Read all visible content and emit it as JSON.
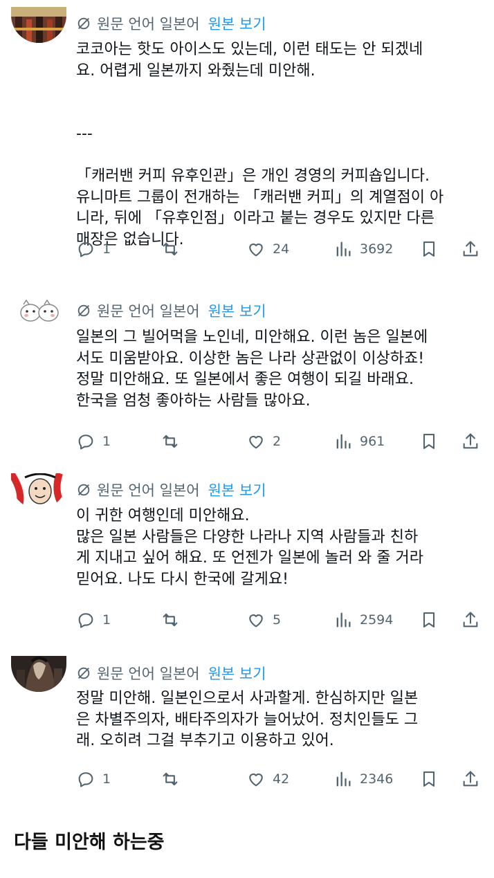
{
  "translate": {
    "label": "원문 언어 일본어",
    "link": "원본 보기"
  },
  "replies": [
    {
      "text": "코코아는 핫도 아이스도 있는데, 이런 태도는 안 되겠네\n요. 어렵게 일본까지 와줬는데 미안해.\n\n\n---\n\n「캐러밴 커피 유후인관」은 개인 경영의 커피숍입니다.\n유니마트 그룹이 전개하는 「캐러밴 커피」의 계열점이 아\n니라, 뒤에 「유후인점」이라고 붙는 경우도 있지만 다른\n매장은 없습니다.",
      "replies": "1",
      "likes": "24",
      "views": "3692"
    },
    {
      "text": "일본의 그 빌어먹을 노인네, 미안해요. 이런 놈은 일본에\n서도 미움받아요. 이상한 놈은 나라 상관없이 이상하죠!\n정말 미안해요. 또 일본에서 좋은 여행이 되길 바래요.\n한국을 엄청 좋아하는 사람들 많아요.",
      "replies": "1",
      "likes": "2",
      "views": "961"
    },
    {
      "text": "이 귀한 여행인데 미안해요.\n많은 일본 사람들은 다양한 나라나 지역 사람들과 친하\n게 지내고 싶어 해요. 또 언젠가 일본에 놀러 와 줄 거라\n믿어요. 나도 다시 한국에 갈게요!",
      "replies": "1",
      "likes": "5",
      "views": "2594"
    },
    {
      "text": "정말 미안해. 일본인으로서 사과할게. 한심하지만 일본\n은 차별주의자, 배타주의자가 늘어났어. 정치인들도 그\n래. 오히려 그걸 부추기고 이용하고 있어.",
      "replies": "1",
      "likes": "42",
      "views": "2346"
    }
  ],
  "footer": {
    "caption": "다들 미안해 하는중"
  },
  "colors": {
    "link": "#1d9bf0",
    "muted": "#536471",
    "text": "#0f1419"
  }
}
